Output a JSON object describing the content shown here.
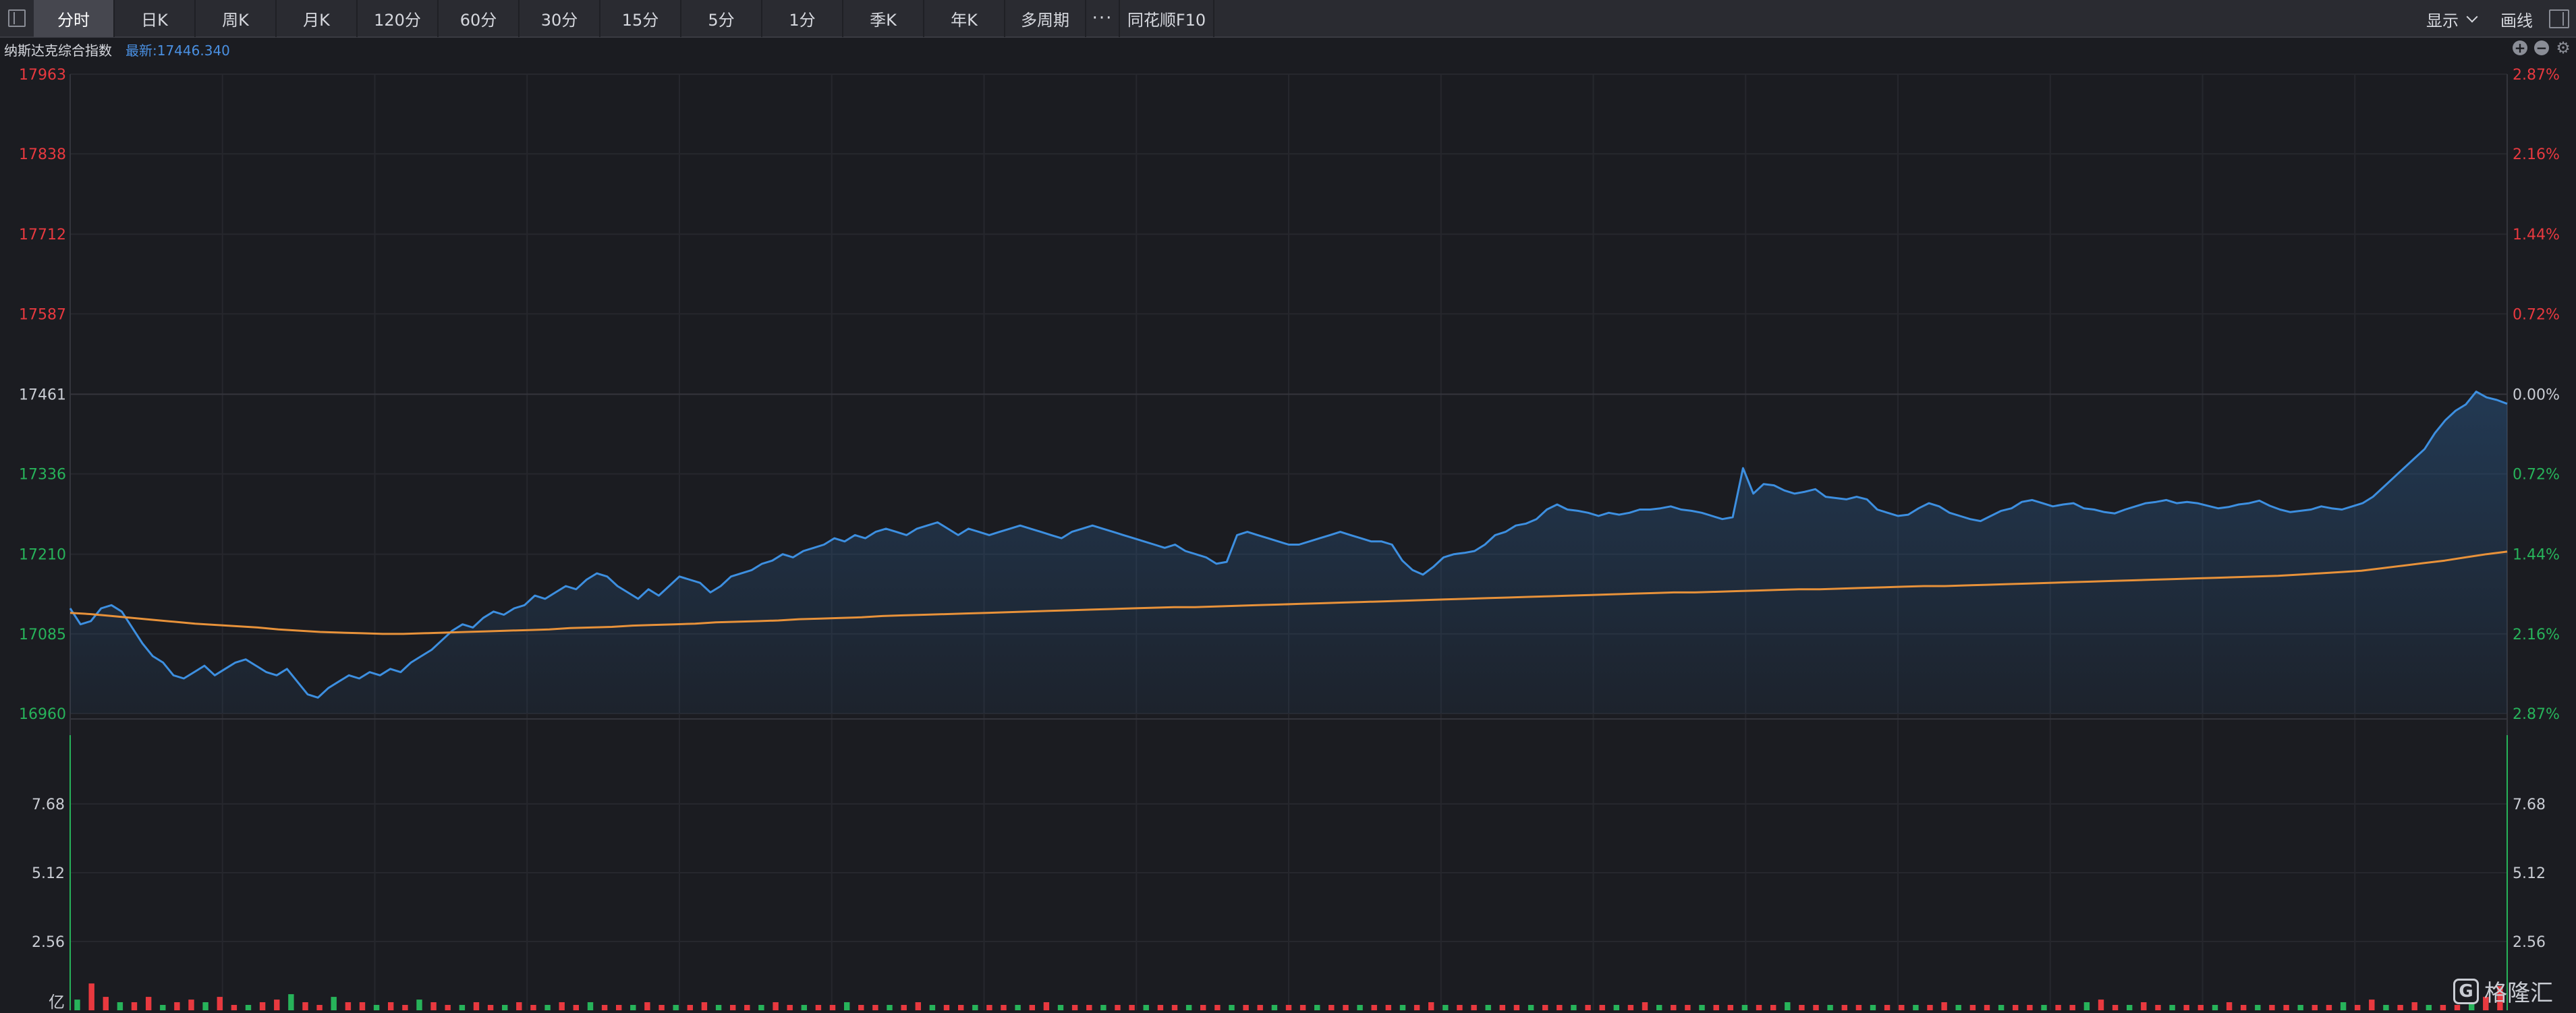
{
  "toolbar": {
    "tabs": [
      {
        "label": "分时",
        "active": true
      },
      {
        "label": "日K"
      },
      {
        "label": "周K"
      },
      {
        "label": "月K"
      },
      {
        "label": "120分"
      },
      {
        "label": "60分"
      },
      {
        "label": "30分"
      },
      {
        "label": "15分"
      },
      {
        "label": "5分"
      },
      {
        "label": "1分"
      },
      {
        "label": "季K"
      },
      {
        "label": "年K"
      },
      {
        "label": "多周期"
      }
    ],
    "more_label": "···",
    "f10_label": "同花顺F10",
    "display_label": "显示",
    "draw_label": "画线"
  },
  "info": {
    "name": "纳斯达克综合指数",
    "latest": "最新:17446.340"
  },
  "watermark": {
    "text": "格隆汇"
  },
  "colors": {
    "price_line": "#3d8fe0",
    "avg_line": "#e8923a",
    "up": "#e8393f",
    "down": "#27b35a",
    "neutral": "#c9ccd3"
  },
  "chart_data": {
    "type": "line",
    "price_axis": {
      "ticks": [
        {
          "value": 17963,
          "label": "17963",
          "pct": "2.87%",
          "side": "up"
        },
        {
          "value": 17838,
          "label": "17838",
          "pct": "2.16%",
          "side": "up"
        },
        {
          "value": 17712,
          "label": "17712",
          "pct": "1.44%",
          "side": "up"
        },
        {
          "value": 17587,
          "label": "17587",
          "pct": "0.72%",
          "side": "up"
        },
        {
          "value": 17461,
          "label": "17461",
          "pct": "0.00%",
          "side": "mid"
        },
        {
          "value": 17336,
          "label": "17336",
          "pct": "0.72%",
          "side": "down"
        },
        {
          "value": 17210,
          "label": "17210",
          "pct": "1.44%",
          "side": "down"
        },
        {
          "value": 17085,
          "label": "17085",
          "pct": "2.16%",
          "side": "down"
        },
        {
          "value": 16960,
          "label": "16960",
          "pct": "2.87%",
          "side": "down"
        }
      ],
      "range": [
        16960,
        17963
      ]
    },
    "volume_axis": {
      "ticks": [
        {
          "value": 7.68,
          "label": "7.68"
        },
        {
          "value": 5.12,
          "label": "5.12"
        },
        {
          "value": 2.56,
          "label": "2.56"
        }
      ],
      "unit": "亿",
      "range": [
        0,
        10.24
      ]
    },
    "price": [
      17125,
      17100,
      17105,
      17125,
      17130,
      17120,
      17095,
      17070,
      17050,
      17040,
      17020,
      17015,
      17025,
      17035,
      17020,
      17030,
      17040,
      17045,
      17035,
      17025,
      17020,
      17030,
      17010,
      16990,
      16985,
      17000,
      17010,
      17020,
      17015,
      17025,
      17020,
      17030,
      17025,
      17040,
      17050,
      17060,
      17075,
      17090,
      17100,
      17095,
      17110,
      17120,
      17115,
      17125,
      17130,
      17145,
      17140,
      17150,
      17160,
      17155,
      17170,
      17180,
      17175,
      17160,
      17150,
      17140,
      17155,
      17145,
      17160,
      17175,
      17170,
      17165,
      17150,
      17160,
      17175,
      17180,
      17185,
      17195,
      17200,
      17210,
      17205,
      17215,
      17220,
      17225,
      17235,
      17230,
      17240,
      17235,
      17245,
      17250,
      17245,
      17240,
      17250,
      17255,
      17260,
      17250,
      17240,
      17250,
      17245,
      17240,
      17245,
      17250,
      17255,
      17250,
      17245,
      17240,
      17235,
      17245,
      17250,
      17255,
      17250,
      17245,
      17240,
      17235,
      17230,
      17225,
      17220,
      17225,
      17215,
      17210,
      17205,
      17195,
      17198,
      17240,
      17245,
      17240,
      17235,
      17230,
      17225,
      17225,
      17230,
      17235,
      17240,
      17245,
      17240,
      17235,
      17230,
      17230,
      17225,
      17200,
      17185,
      17178,
      17190,
      17205,
      17210,
      17212,
      17215,
      17225,
      17240,
      17245,
      17255,
      17258,
      17265,
      17280,
      17288,
      17280,
      17278,
      17275,
      17270,
      17275,
      17272,
      17275,
      17280,
      17280,
      17282,
      17285,
      17280,
      17278,
      17275,
      17270,
      17265,
      17268,
      17345,
      17305,
      17320,
      17318,
      17310,
      17305,
      17308,
      17312,
      17300,
      17298,
      17296,
      17300,
      17296,
      17280,
      17275,
      17270,
      17272,
      17282,
      17290,
      17285,
      17275,
      17270,
      17265,
      17262,
      17270,
      17278,
      17282,
      17292,
      17295,
      17290,
      17285,
      17288,
      17290,
      17282,
      17280,
      17276,
      17274,
      17280,
      17285,
      17290,
      17292,
      17295,
      17290,
      17292,
      17290,
      17286,
      17282,
      17284,
      17288,
      17290,
      17294,
      17286,
      17280,
      17276,
      17278,
      17280,
      17285,
      17282,
      17280,
      17285,
      17290,
      17300,
      17315,
      17330,
      17345,
      17360,
      17375,
      17400,
      17420,
      17435,
      17445,
      17465,
      17456,
      17452,
      17446
    ],
    "avg": [
      17118,
      17116,
      17113,
      17110,
      17107,
      17104,
      17101,
      17099,
      17097,
      17095,
      17092,
      17090,
      17088,
      17087,
      17086,
      17085,
      17085,
      17086,
      17087,
      17088,
      17089,
      17090,
      17091,
      17092,
      17094,
      17095,
      17096,
      17098,
      17099,
      17100,
      17101,
      17103,
      17104,
      17105,
      17106,
      17108,
      17109,
      17110,
      17111,
      17113,
      17114,
      17115,
      17116,
      17117,
      17118,
      17119,
      17120,
      17121,
      17122,
      17123,
      17124,
      17125,
      17126,
      17127,
      17127,
      17128,
      17129,
      17130,
      17131,
      17132,
      17133,
      17134,
      17135,
      17136,
      17137,
      17138,
      17139,
      17140,
      17141,
      17142,
      17143,
      17144,
      17145,
      17146,
      17147,
      17148,
      17149,
      17150,
      17150,
      17151,
      17152,
      17153,
      17154,
      17155,
      17155,
      17156,
      17157,
      17158,
      17159,
      17160,
      17160,
      17161,
      17162,
      17163,
      17164,
      17165,
      17166,
      17167,
      17168,
      17169,
      17170,
      17171,
      17172,
      17173,
      17174,
      17175,
      17176,
      17178,
      17180,
      17182,
      17184,
      17188,
      17192,
      17196,
      17200,
      17205,
      17210,
      17214
    ],
    "volume": [
      0.4,
      1.0,
      0.5,
      0.3,
      0.3,
      0.5,
      0.2,
      0.3,
      0.4,
      0.3,
      0.5,
      0.2,
      0.2,
      0.3,
      0.4,
      0.6,
      0.3,
      0.2,
      0.5,
      0.3,
      0.3,
      0.2,
      0.3,
      0.2,
      0.4,
      0.3,
      0.2,
      0.2,
      0.3,
      0.2,
      0.2,
      0.3,
      0.2,
      0.2,
      0.3,
      0.2,
      0.3,
      0.2,
      0.2,
      0.2,
      0.3,
      0.2,
      0.2,
      0.2,
      0.3,
      0.2,
      0.2,
      0.2,
      0.2,
      0.3,
      0.2,
      0.2,
      0.2,
      0.2,
      0.3,
      0.2,
      0.2,
      0.2,
      0.2,
      0.3,
      0.2,
      0.2,
      0.2,
      0.2,
      0.2,
      0.2,
      0.2,
      0.2,
      0.3,
      0.2,
      0.2,
      0.2,
      0.2,
      0.2,
      0.2,
      0.2,
      0.2,
      0.2,
      0.2,
      0.2,
      0.2,
      0.2,
      0.2,
      0.2,
      0.2,
      0.2,
      0.2,
      0.2,
      0.2,
      0.2,
      0.2,
      0.2,
      0.2,
      0.2,
      0.2,
      0.3,
      0.2,
      0.2,
      0.2,
      0.2,
      0.2,
      0.2,
      0.2,
      0.2,
      0.2,
      0.2,
      0.2,
      0.2,
      0.2,
      0.2,
      0.3,
      0.2,
      0.2,
      0.2,
      0.2,
      0.2,
      0.2,
      0.2,
      0.2,
      0.2,
      0.3,
      0.2,
      0.2,
      0.2,
      0.2,
      0.2,
      0.2,
      0.2,
      0.2,
      0.2,
      0.2,
      0.3,
      0.2,
      0.2,
      0.2,
      0.2,
      0.2,
      0.2,
      0.2,
      0.2,
      0.2,
      0.3,
      0.4,
      0.2,
      0.2,
      0.3,
      0.2,
      0.2,
      0.2,
      0.2,
      0.2,
      0.3,
      0.2,
      0.2,
      0.2,
      0.2,
      0.2,
      0.2,
      0.2,
      0.3,
      0.2,
      0.4,
      0.2,
      0.2,
      0.3,
      0.2,
      0.2,
      0.2,
      0.3,
      0.5,
      0.9
    ],
    "grid": true
  }
}
